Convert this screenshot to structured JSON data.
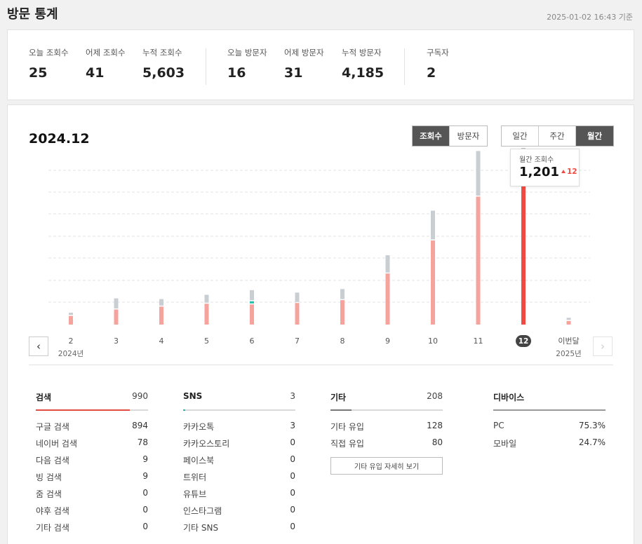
{
  "header": {
    "title": "방문 통계",
    "timestamp": "2025-01-02 16:43 기준"
  },
  "summary": {
    "stats": [
      {
        "label": "오늘 조회수",
        "value": "25"
      },
      {
        "label": "어제 조회수",
        "value": "41"
      },
      {
        "label": "누적 조회수",
        "value": "5,603"
      },
      {
        "label": "오늘 방문자",
        "value": "16"
      },
      {
        "label": "어제 방문자",
        "value": "31"
      },
      {
        "label": "누적 방문자",
        "value": "4,185"
      },
      {
        "label": "구독자",
        "value": "2"
      }
    ]
  },
  "chart_panel": {
    "period": "2024.12",
    "metric_tabs": [
      {
        "label": "조회수",
        "active": true
      },
      {
        "label": "방문자",
        "active": false
      }
    ],
    "range_tabs": [
      {
        "label": "일간",
        "active": false
      },
      {
        "label": "주간",
        "active": false
      },
      {
        "label": "월간",
        "active": true
      }
    ],
    "tooltip": {
      "label": "월간 조회수",
      "value": "1,201",
      "delta": "12"
    },
    "year_start": "2024년",
    "year_end": "2025년"
  },
  "chart_data": {
    "type": "bar",
    "stacked": true,
    "categories": [
      "2",
      "3",
      "4",
      "5",
      "6",
      "7",
      "8",
      "9",
      "10",
      "11",
      "12",
      "이번달"
    ],
    "selected_category": "12",
    "grid": true,
    "ylim": [
      0,
      1380
    ],
    "series": [
      {
        "color": "#f7a39d",
        "highlight_color": "#f04b42",
        "values": [
          60,
          105,
          125,
          145,
          140,
          150,
          170,
          355,
          585,
          890,
          1010,
          25
        ]
      },
      {
        "color": "#22c0a8",
        "values": [
          0,
          0,
          0,
          0,
          15,
          0,
          0,
          0,
          0,
          0,
          0,
          0
        ]
      },
      {
        "color": "#c9ced3",
        "highlight_color": "#97a2ad",
        "values": [
          15,
          70,
          45,
          55,
          70,
          65,
          70,
          120,
          200,
          310,
          210,
          15
        ]
      }
    ]
  },
  "breakdown": {
    "search": {
      "title": "검색",
      "count": "990",
      "color": "#e04c3f",
      "fill_fraction": 0.84,
      "rows": [
        {
          "label": "구글 검색",
          "count": "894"
        },
        {
          "label": "네이버 검색",
          "count": "78"
        },
        {
          "label": "다음 검색",
          "count": "9"
        },
        {
          "label": "빙 검색",
          "count": "9"
        },
        {
          "label": "줌 검색",
          "count": "0"
        },
        {
          "label": "야후 검색",
          "count": "0"
        },
        {
          "label": "기타 검색",
          "count": "0"
        }
      ]
    },
    "sns": {
      "title": "SNS",
      "count": "3",
      "color": "#22c0a8",
      "fill_fraction": 0.02,
      "rows": [
        {
          "label": "카카오톡",
          "count": "3"
        },
        {
          "label": "카카오스토리",
          "count": "0"
        },
        {
          "label": "페이스북",
          "count": "0"
        },
        {
          "label": "트위터",
          "count": "0"
        },
        {
          "label": "유튜브",
          "count": "0"
        },
        {
          "label": "인스타그램",
          "count": "0"
        },
        {
          "label": "기타 SNS",
          "count": "0"
        }
      ]
    },
    "etc": {
      "title": "기타",
      "count": "208",
      "color": "#777777",
      "fill_fraction": 0.19,
      "rows": [
        {
          "label": "기타 유입",
          "count": "128"
        },
        {
          "label": "직접 유입",
          "count": "80"
        }
      ],
      "detail_button": "기타 유입 자세히 보기"
    },
    "device": {
      "title": "디바이스",
      "count": "",
      "color": "#999999",
      "fill_fraction": 1.0,
      "rows": [
        {
          "label": "PC",
          "count": "75.3%"
        },
        {
          "label": "모바일",
          "count": "24.7%"
        }
      ]
    }
  }
}
